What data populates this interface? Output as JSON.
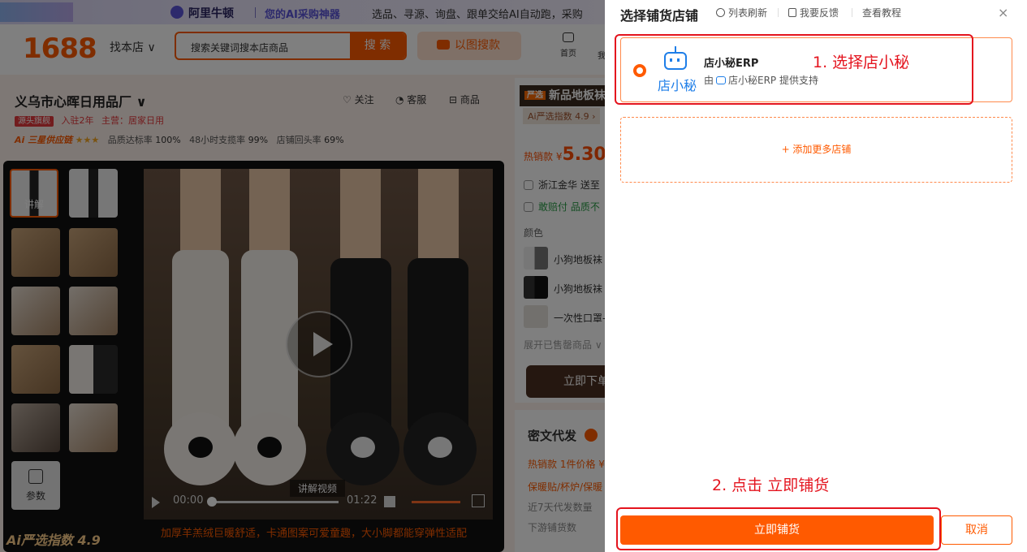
{
  "topbar": {
    "brand": "阿里牛顿",
    "tagline": "您的AI采购神器",
    "desc": "选品、寻源、询盘、跟单交给AI自动跑，采购"
  },
  "header": {
    "logo": "1688",
    "find_shop": "找本店 ∨",
    "search_placeholder": "搜索关键词搜本店商品",
    "search_button": "搜 索",
    "image_search": "以图搜款",
    "home": "首页",
    "home2": "我"
  },
  "shop": {
    "name": "义乌市心晖日用品厂 ∨",
    "follow": "关注",
    "service": "客服",
    "products": "商品",
    "badge": "源头旗舰",
    "years": "入驻2年",
    "category": "主营：居家日用",
    "ai_label": "Ai 三星供应链",
    "stars": "★★★",
    "quality_label": "品质达标率",
    "quality": "100%",
    "ship_label": "48小时支揽率",
    "ship": "99%",
    "repeat_label": "店铺回头率",
    "repeat": "69%"
  },
  "gallery": {
    "first_thumb_label": "讲解",
    "params_label": "参数",
    "video_label": "讲解视频",
    "time_current": "00:00",
    "time_total": "01:22",
    "ai_index": "Ai严选指数 4.9",
    "description": "加厚羊羔绒巨暖舒适，卡通图案可爱童趣，大小脚都能穿弹性适配"
  },
  "product": {
    "title": "新品地板袜",
    "title_tag": "严选",
    "ai_index": "Ai严选指数 4.9 ›",
    "hot_label": "热销款 ¥",
    "price": "5.30",
    "ship_from": "浙江金华 送至",
    "guarantee": "敢赔付  品质不",
    "color_label": "颜色",
    "colors": [
      "小狗地板袜",
      "小狗地板袜",
      "一次性口罩-"
    ],
    "expand": "展开已售罄商品 ∨",
    "buy": "立即下单",
    "dropship_title": "密文代发",
    "row1": "热销款  1件价格 ¥",
    "row2": "保暖贴/杯炉/保暖",
    "row3": "近7天代发数量",
    "row4": "下游铺货数"
  },
  "dialog": {
    "title": "选择铺货店铺",
    "refresh": "列表刷新",
    "feedback": "我要反馈",
    "tutorial": "查看教程",
    "close": "×",
    "shop_name": "店小秘ERP",
    "shop_logo_text": "店小秘",
    "shop_sub_prefix": "由",
    "shop_sub_suffix": "店小秘ERP 提供支持",
    "add_more": "+ 添加更多店铺",
    "confirm": "立即铺货",
    "cancel": "取消"
  },
  "annotations": {
    "step1": "1. 选择店小秘",
    "step2": "2. 点击 立即铺货"
  },
  "colors": {
    "accent": "#ff5a00",
    "annotation": "#e4141e",
    "robot_blue": "#1e7ee8"
  }
}
